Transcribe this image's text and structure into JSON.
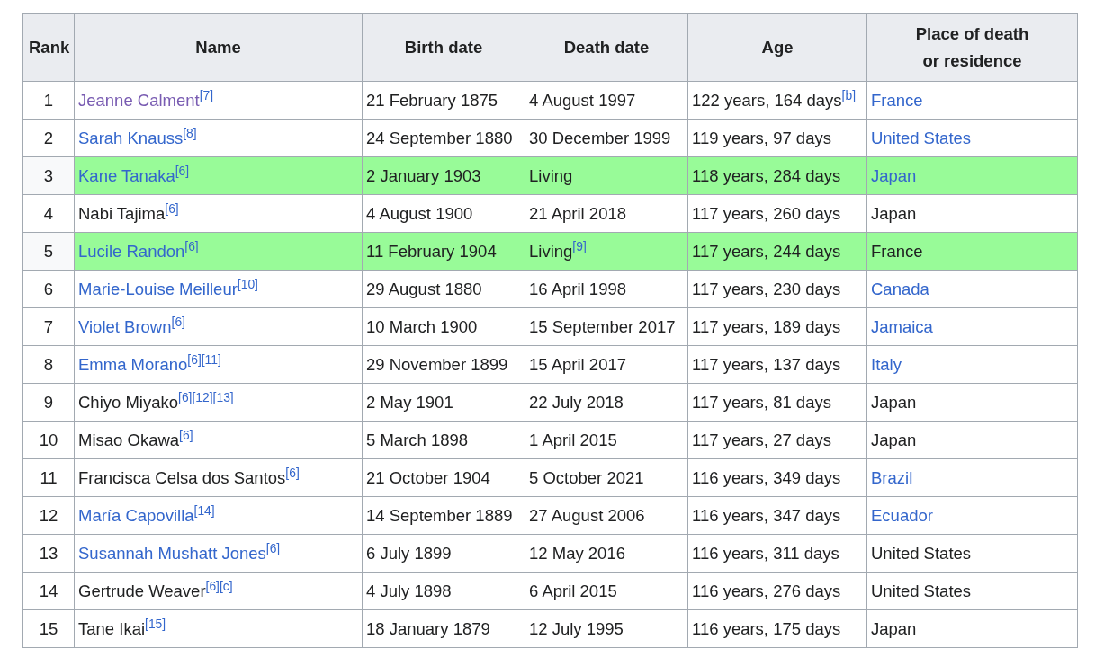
{
  "table": {
    "columns": [
      "Rank",
      "Name",
      "Birth date",
      "Death date",
      "Age",
      "Place of death or residence"
    ],
    "rows": [
      {
        "rank": "1",
        "living": false,
        "name": {
          "text": "Jeanne Calment",
          "kind": "visited",
          "refs": [
            "[7]"
          ]
        },
        "birth": "21 February 1875",
        "death": {
          "text": "4 August 1997"
        },
        "age": {
          "text": "122 years, 164 days",
          "refs": [
            "[b]"
          ]
        },
        "place": {
          "text": "France",
          "kind": "link"
        }
      },
      {
        "rank": "2",
        "living": false,
        "name": {
          "text": "Sarah Knauss",
          "kind": "link",
          "refs": [
            "[8]"
          ]
        },
        "birth": "24 September 1880",
        "death": {
          "text": "30 December 1999"
        },
        "age": {
          "text": "119 years, 97 days"
        },
        "place": {
          "text": "United States",
          "kind": "link"
        }
      },
      {
        "rank": "3",
        "living": true,
        "name": {
          "text": "Kane Tanaka",
          "kind": "link",
          "refs": [
            "[6]"
          ]
        },
        "birth": "2 January 1903",
        "death": {
          "text": "Living"
        },
        "age": {
          "text": "118 years, 284 days"
        },
        "place": {
          "text": "Japan",
          "kind": "link"
        }
      },
      {
        "rank": "4",
        "living": false,
        "name": {
          "text": "Nabi Tajima",
          "kind": "plain",
          "refs": [
            "[6]"
          ]
        },
        "birth": "4 August 1900",
        "death": {
          "text": "21 April 2018"
        },
        "age": {
          "text": "117 years, 260 days"
        },
        "place": {
          "text": "Japan",
          "kind": "plain"
        }
      },
      {
        "rank": "5",
        "living": true,
        "name": {
          "text": "Lucile Randon",
          "kind": "link",
          "refs": [
            "[6]"
          ]
        },
        "birth": "11 February 1904",
        "death": {
          "text": "Living",
          "refs": [
            "[9]"
          ]
        },
        "age": {
          "text": "117 years, 244 days"
        },
        "place": {
          "text": "France",
          "kind": "plain"
        }
      },
      {
        "rank": "6",
        "living": false,
        "name": {
          "text": "Marie-Louise Meilleur",
          "kind": "link",
          "refs": [
            "[10]"
          ]
        },
        "birth": "29 August 1880",
        "death": {
          "text": "16 April 1998"
        },
        "age": {
          "text": "117 years, 230 days"
        },
        "place": {
          "text": "Canada",
          "kind": "link"
        }
      },
      {
        "rank": "7",
        "living": false,
        "name": {
          "text": "Violet Brown",
          "kind": "link",
          "refs": [
            "[6]"
          ]
        },
        "birth": "10 March 1900",
        "death": {
          "text": "15 September 2017"
        },
        "age": {
          "text": "117 years, 189 days"
        },
        "place": {
          "text": "Jamaica",
          "kind": "link"
        }
      },
      {
        "rank": "8",
        "living": false,
        "name": {
          "text": "Emma Morano",
          "kind": "link",
          "refs": [
            "[6]",
            "[11]"
          ]
        },
        "birth": "29 November 1899",
        "death": {
          "text": "15 April 2017"
        },
        "age": {
          "text": "117 years, 137 days"
        },
        "place": {
          "text": "Italy",
          "kind": "link"
        }
      },
      {
        "rank": "9",
        "living": false,
        "name": {
          "text": "Chiyo Miyako",
          "kind": "plain",
          "refs": [
            "[6]",
            "[12]",
            "[13]"
          ]
        },
        "birth": "2 May 1901",
        "death": {
          "text": "22 July 2018"
        },
        "age": {
          "text": "117 years, 81 days"
        },
        "place": {
          "text": "Japan",
          "kind": "plain"
        }
      },
      {
        "rank": "10",
        "living": false,
        "name": {
          "text": "Misao Okawa",
          "kind": "plain",
          "refs": [
            "[6]"
          ]
        },
        "birth": "5 March 1898",
        "death": {
          "text": "1 April 2015"
        },
        "age": {
          "text": "117 years, 27 days"
        },
        "place": {
          "text": "Japan",
          "kind": "plain"
        }
      },
      {
        "rank": "11",
        "living": false,
        "name": {
          "text": "Francisca Celsa dos Santos",
          "kind": "plain",
          "refs": [
            "[6]"
          ]
        },
        "birth": "21 October 1904",
        "death": {
          "text": "5 October 2021"
        },
        "age": {
          "text": "116 years, 349 days"
        },
        "place": {
          "text": "Brazil",
          "kind": "link"
        }
      },
      {
        "rank": "12",
        "living": false,
        "name": {
          "text": "María Capovilla",
          "kind": "link",
          "refs": [
            "[14]"
          ]
        },
        "birth": "14 September 1889",
        "death": {
          "text": "27 August 2006"
        },
        "age": {
          "text": "116 years, 347 days"
        },
        "place": {
          "text": "Ecuador",
          "kind": "link"
        }
      },
      {
        "rank": "13",
        "living": false,
        "name": {
          "text": "Susannah Mushatt Jones",
          "kind": "link",
          "refs": [
            "[6]"
          ]
        },
        "birth": "6 July 1899",
        "death": {
          "text": "12 May 2016"
        },
        "age": {
          "text": "116 years, 311 days"
        },
        "place": {
          "text": "United States",
          "kind": "plain"
        }
      },
      {
        "rank": "14",
        "living": false,
        "name": {
          "text": "Gertrude Weaver",
          "kind": "plain",
          "refs": [
            "[6]",
            "[c]"
          ]
        },
        "birth": "4 July 1898",
        "death": {
          "text": "6 April 2015"
        },
        "age": {
          "text": "116 years, 276 days"
        },
        "place": {
          "text": "United States",
          "kind": "plain"
        }
      },
      {
        "rank": "15",
        "living": false,
        "name": {
          "text": "Tane Ikai",
          "kind": "plain",
          "refs": [
            "[15]"
          ]
        },
        "birth": "18 January 1879",
        "death": {
          "text": "12 July 1995"
        },
        "age": {
          "text": "116 years, 175 days"
        },
        "place": {
          "text": "Japan",
          "kind": "plain"
        }
      }
    ]
  }
}
